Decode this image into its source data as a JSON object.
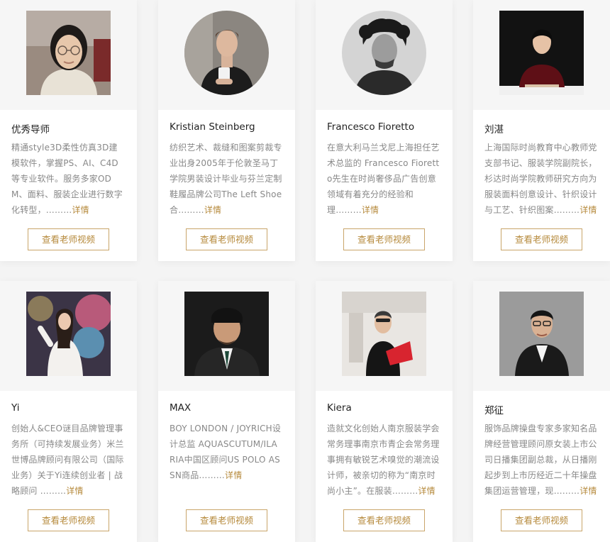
{
  "teachers": [
    {
      "name": "优秀导师",
      "desc": "精通style3D柔性仿真3D建模软件，掌握PS、AI、C4D等专业软件。服务多家ODM、面料、服装企业进行数字化转型，………",
      "more_label": "详情",
      "button_label": "查看老师视频",
      "photo": "woman-glasses-portrait"
    },
    {
      "name": "Kristian Steinberg",
      "desc": "纺织艺术、裁缝和图案剪裁专业出身2005年于伦敦圣马丁学院男装设计毕业与芬兰定制鞋履品牌公司The Left Shoe 合………",
      "more_label": "详情",
      "button_label": "查看老师视频",
      "photo": "man-with-cup-portrait"
    },
    {
      "name": "Francesco Fioretto",
      "desc": "在意大利马兰戈尼上海担任艺术总监的 Francesco Fioretto先生在时尚奢侈品广告创意领域有着充分的经验和理………",
      "more_label": "详情",
      "button_label": "查看老师视频",
      "photo": "man-curly-hair-bw-portrait"
    },
    {
      "name": "刘湛",
      "desc": "上海国际时尚教育中心教师党支部书记、服装学院副院长，杉达时尚学院教师研究方向为服装面料创意设计、针织设计与工艺、针织图案………",
      "more_label": "详情",
      "button_label": "查看老师视频",
      "photo": "woman-red-dress-portrait"
    },
    {
      "name": "Yi",
      "desc": "创始人&CEO谜目品牌管理事务所（可持续发展业务）米兰世博品牌顾问有限公司（国际业务）关于Yi连续创业者 | 战略顾问 ………",
      "more_label": "详情",
      "button_label": "查看老师视频",
      "photo": "woman-white-suit-portrait"
    },
    {
      "name": "MAX",
      "desc": "BOY LONDON / JOYRICH设计总监 AQUASCUTUM/ILARIA中国区顾问US POLO ASSN商品………",
      "more_label": "详情",
      "button_label": "查看老师视频",
      "photo": "man-cap-suit-portrait"
    },
    {
      "name": "Kiera",
      "desc": "造就文化创始人南京服装学会常务理事南京市青企会常务理事拥有敏锐艺术嗅觉的潮流设计师，被亲切的称为“南京时尚小主”。在服装………",
      "more_label": "详情",
      "button_label": "查看老师视频",
      "photo": "woman-black-outfit-portrait"
    },
    {
      "name": "郑征",
      "desc": "服饰品牌操盘专家多家知名品牌经营管理顾问原女装上市公司日播集团副总裁，从日播刚起步到上市历经近二十年操盘集团运营管理，现………",
      "more_label": "详情",
      "button_label": "查看老师视频",
      "photo": "man-suit-glasses-portrait"
    }
  ]
}
